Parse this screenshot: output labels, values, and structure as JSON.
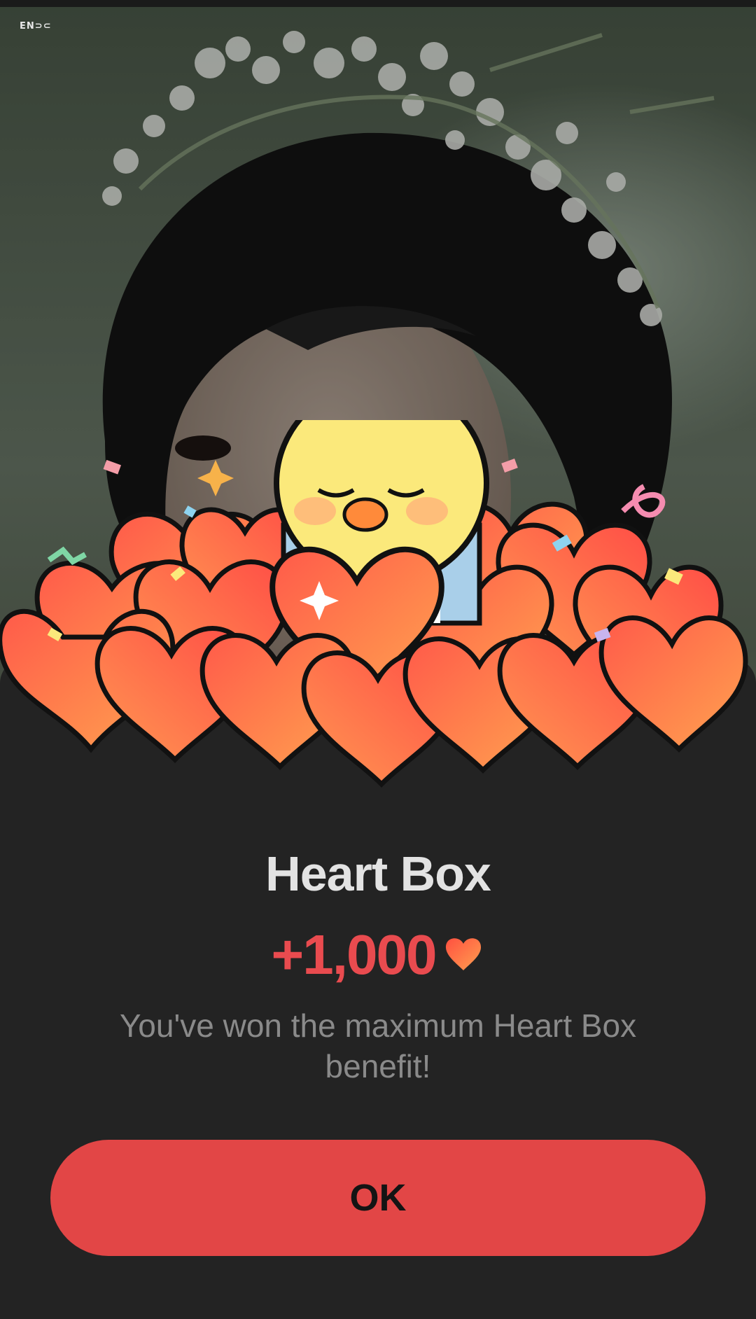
{
  "background": {
    "photo": "artist-portrait"
  },
  "brand": {
    "logo_text": "EN⊃⊂"
  },
  "dialog": {
    "title": "Heart Box",
    "amount": "+1,000",
    "message": "You've won the maximum Heart Box benefit!",
    "ok_label": "OK"
  },
  "colors": {
    "accent": "#e24646",
    "amount": "#e94b4f",
    "sheet": "#232323",
    "title": "#e3e3e3",
    "message": "#8a8a8a"
  },
  "icons": {
    "heart": "heart-icon",
    "mascot": "chick-mascot",
    "box": "gift-box-icon"
  }
}
